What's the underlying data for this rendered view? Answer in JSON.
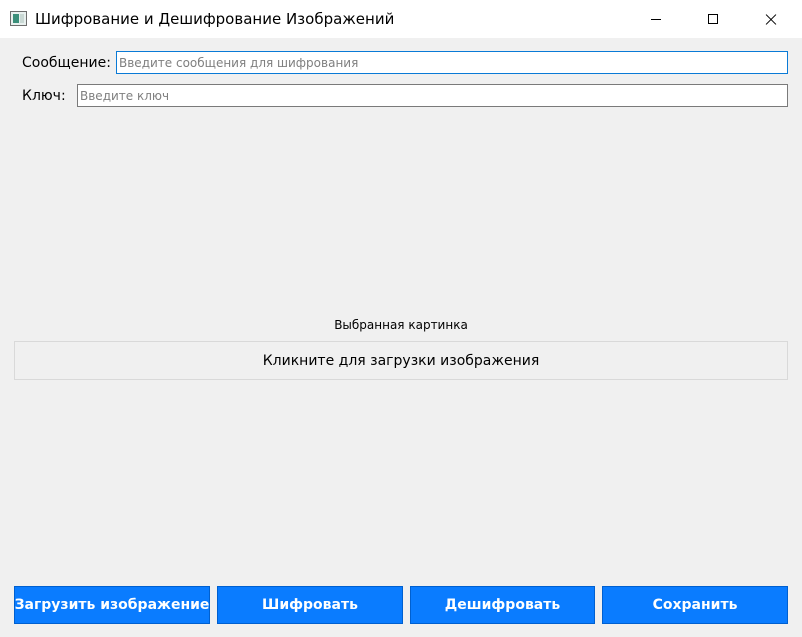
{
  "window": {
    "title": "Шифрование и Дешифрование Изображений",
    "icon": "app-icon",
    "controls": {
      "minimize": "minimize-icon",
      "maximize": "maximize-icon",
      "close": "close-icon"
    }
  },
  "form": {
    "message_label": "Сообщение:",
    "message_value": "",
    "message_placeholder": "Введите сообщения для шифрования",
    "key_label": "Ключ:",
    "key_value": "",
    "key_placeholder": "Введите ключ"
  },
  "image": {
    "caption": "Выбранная картинка",
    "drop_label": "Кликните для загрузки изображения"
  },
  "buttons": {
    "load": "Загрузить изображение",
    "encrypt": "Шифровать",
    "decrypt": "Дешифровать",
    "save": "Сохранить"
  },
  "colors": {
    "accent_button": "#0a7cff",
    "focus_border": "#0a7ad6",
    "background": "#f0f0f0"
  }
}
